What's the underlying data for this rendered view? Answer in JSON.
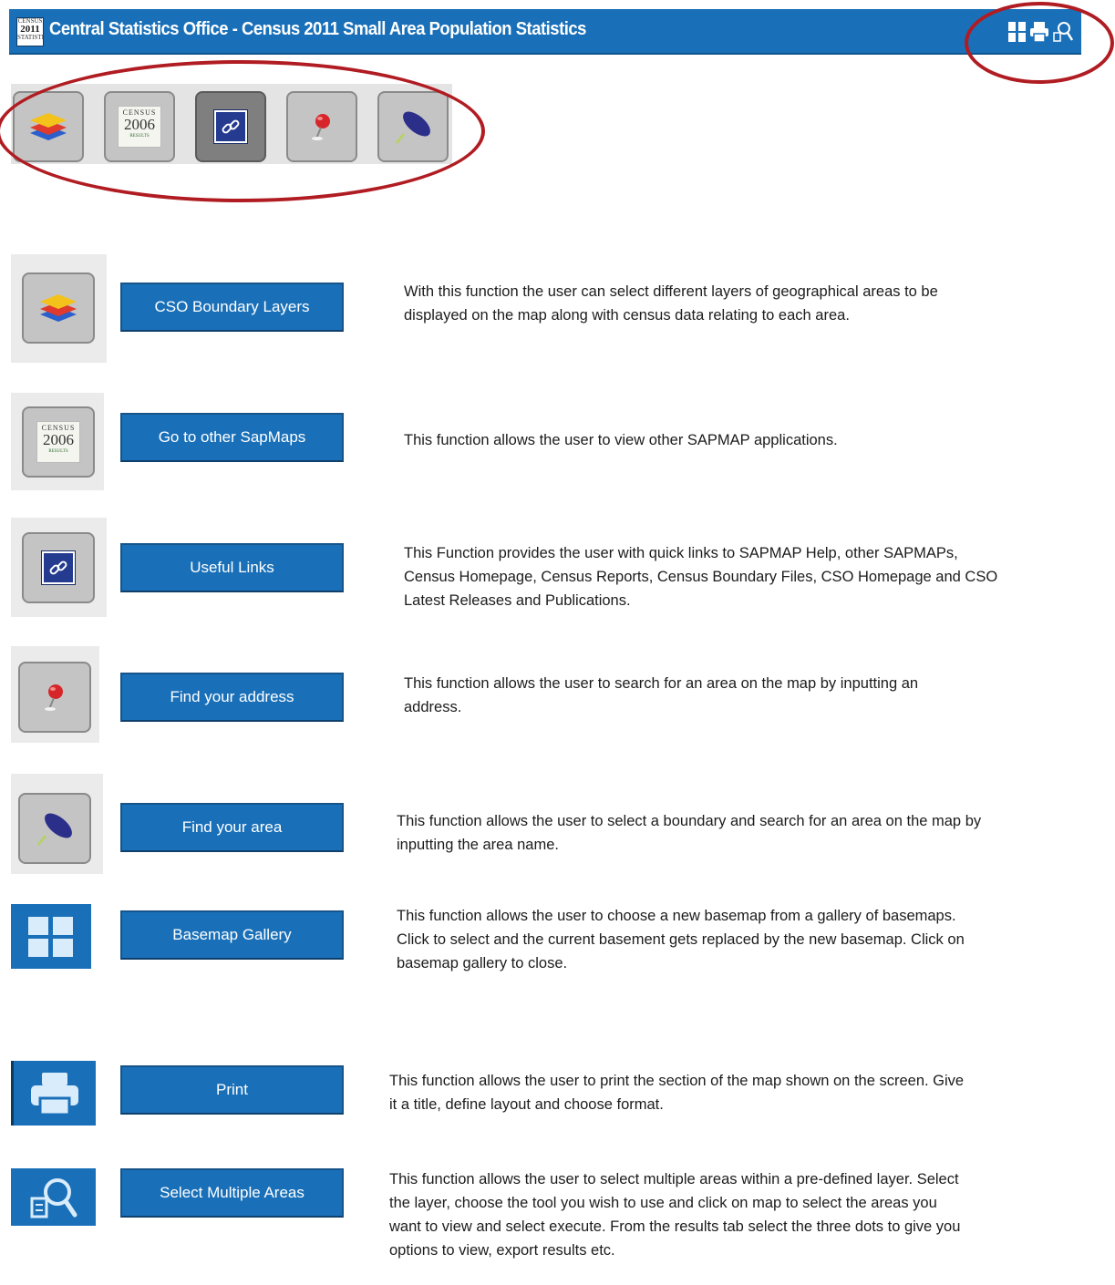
{
  "header": {
    "logo": {
      "top": "CENSUS",
      "year": "2011",
      "bottom": "STATISTICS"
    },
    "title": "Central Statistics Office - Census 2011 Small Area Population Statistics",
    "icons": [
      "basemap-gallery-icon",
      "print-icon",
      "select-areas-icon"
    ]
  },
  "toolbar": {
    "buttons": [
      {
        "name": "cso-boundary-layers",
        "icon": "layers-icon"
      },
      {
        "name": "other-sapmaps",
        "icon": "census-2006-icon"
      },
      {
        "name": "useful-links",
        "icon": "link-icon",
        "active": true
      },
      {
        "name": "find-address",
        "icon": "pushpin-icon"
      },
      {
        "name": "find-area",
        "icon": "pen-icon"
      }
    ]
  },
  "census_badge": {
    "top": "CENSUS",
    "year": "2006",
    "bottom": "RESULTS"
  },
  "functions": [
    {
      "label": "CSO Boundary Layers",
      "description": [
        "With this function the user can select different layers of geographical areas to be",
        "displayed on the map along with census data relating to each area."
      ]
    },
    {
      "label": "Go to other SapMaps",
      "description": [
        "This function allows the user to view other SAPMAP applications."
      ]
    },
    {
      "label": "Useful Links",
      "description": [
        "This Function provides the user with quick links to SAPMAP Help, other SAPMAPs,",
        "Census Homepage, Census Reports, Census Boundary Files, CSO Homepage and CSO",
        "Latest Releases and Publications."
      ]
    },
    {
      "label": "Find your address",
      "description": [
        "This function allows the user to search for an area on the map by inputting an",
        "address."
      ]
    },
    {
      "label": "Find your area",
      "description": [
        "This function allows the user to select a boundary and search for an area on the map by",
        "inputting the area name."
      ]
    },
    {
      "label": "Basemap Gallery",
      "description": [
        "This function allows the user to choose a new basemap from a gallery of basemaps.",
        "Click to select and the current basement gets replaced by the new basemap.  Click on",
        "basemap gallery to close."
      ]
    },
    {
      "label": "Print",
      "description": [
        "This function allows the user to print the section of the map shown on the screen.  Give",
        "it a title, define layout and choose format."
      ]
    },
    {
      "label": "Select Multiple Areas",
      "description": [
        "This function allows the user to select multiple areas within a pre-defined layer.  Select",
        "the layer, choose the tool you wish to use and click on map to select the areas you",
        "want to view and select execute.  From the results tab select the three dots to give you",
        "options to view, export results etc."
      ]
    }
  ],
  "colors": {
    "brand_blue": "#1a70b8",
    "annotation_red": "#b01c22",
    "button_grey": "#c4c4c4"
  }
}
